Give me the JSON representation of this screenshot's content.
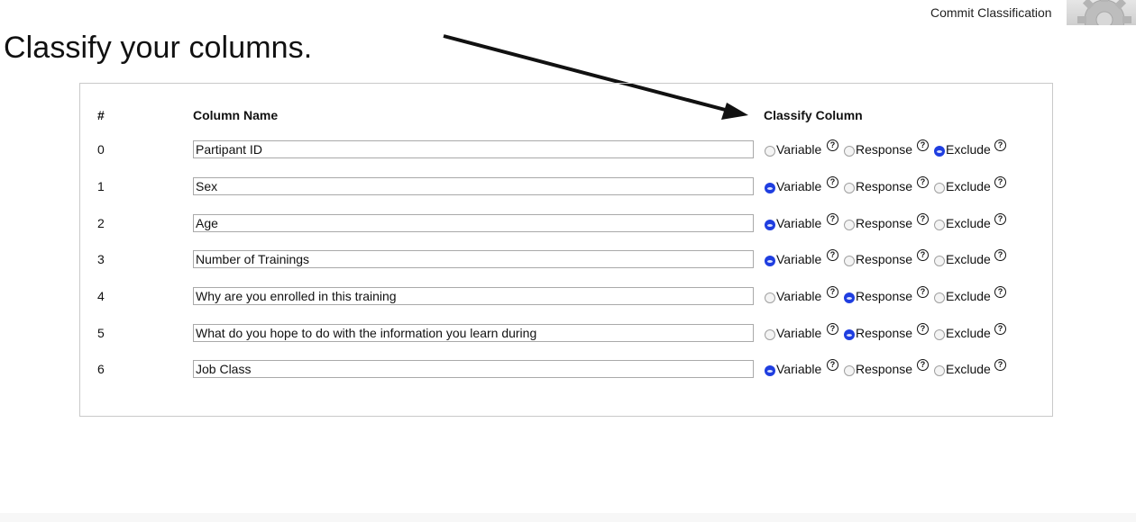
{
  "header": {
    "commit_label": "Commit Classification",
    "page_title": "Classify your columns."
  },
  "table": {
    "col_index": "#",
    "col_name": "Column Name",
    "col_classify": "Classify Column",
    "option_labels": {
      "variable": "Variable",
      "response": "Response",
      "exclude": "Exclude"
    },
    "help_glyph": "?",
    "rows": [
      {
        "index": "0",
        "name": "Partipant ID",
        "selected": "exclude"
      },
      {
        "index": "1",
        "name": "Sex",
        "selected": "variable"
      },
      {
        "index": "2",
        "name": "Age",
        "selected": "variable"
      },
      {
        "index": "3",
        "name": "Number of Trainings",
        "selected": "variable"
      },
      {
        "index": "4",
        "name": "Why are you enrolled in this training",
        "selected": "response"
      },
      {
        "index": "5",
        "name": "What do you hope to do with the information you learn during",
        "selected": "response"
      },
      {
        "index": "6",
        "name": "Job Class",
        "selected": "variable"
      }
    ]
  },
  "icons": {
    "settings": "gear-icon",
    "pointer": "arrow-icon",
    "help": "help-icon"
  },
  "colors": {
    "radio_selected": "#1f3ee0",
    "border": "#c9c9c9"
  }
}
